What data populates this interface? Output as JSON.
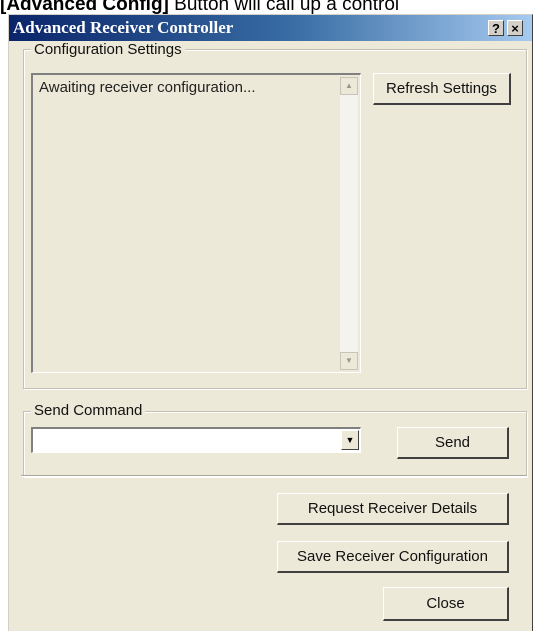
{
  "document": {
    "snippet_prefix": "[Advanced Config]",
    "snippet_rest": " Button will call up a control"
  },
  "window": {
    "title": "Advanced Receiver Controller",
    "help_label": "?",
    "close_label": "×"
  },
  "config_group": {
    "label": "Configuration Settings",
    "list_text": "Awaiting receiver configuration...",
    "refresh_label": "Refresh Settings"
  },
  "send_group": {
    "label": "Send Command",
    "command_value": "",
    "send_label": "Send"
  },
  "actions": {
    "request_details_label": "Request Receiver Details",
    "save_config_label": "Save Receiver Configuration",
    "close_label": "Close"
  },
  "icons": {
    "scroll_up": "scroll-up-arrow-icon",
    "scroll_down": "scroll-down-arrow-icon",
    "dropdown": "dropdown-arrow-icon"
  },
  "colors": {
    "titlebar_start": "#0a246a",
    "titlebar_end": "#a6caf0",
    "dialog_face": "#ece9d8"
  }
}
